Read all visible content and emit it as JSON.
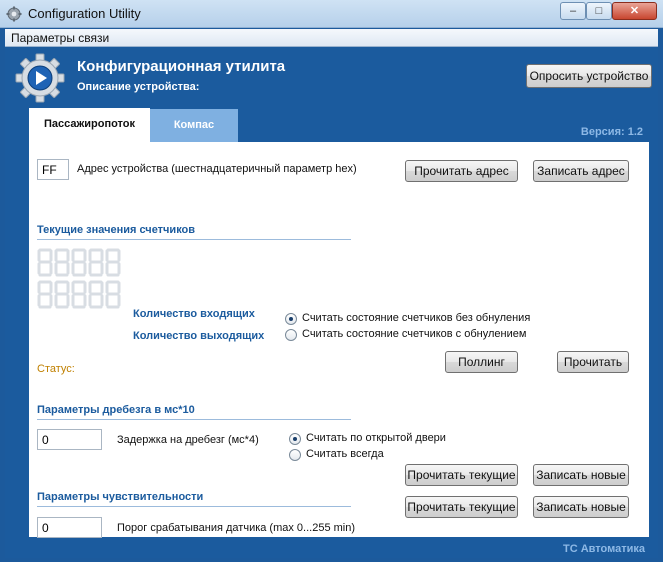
{
  "window": {
    "title": "Configuration Utility",
    "minimize": "–",
    "maximize": "□",
    "close": "✕"
  },
  "menu": {
    "items": [
      "Параметры связи"
    ]
  },
  "header": {
    "title": "Конфигурационная утилита",
    "subtitle": "Описание устройства:",
    "query_button": "Опросить устройство"
  },
  "tabs": [
    {
      "label": "Пассажиропоток",
      "active": true
    },
    {
      "label": "Компас",
      "active": false
    }
  ],
  "version": "Версия: 1.2",
  "address": {
    "value": "FF",
    "label": "Адрес устройства (шестнадцатеричный параметр hex)",
    "read_button": "Прочитать адрес",
    "write_button": "Записать адрес"
  },
  "counters": {
    "title": "Текущие значения счетчиков",
    "in_label": "Количество входящих",
    "out_label": "Количество выходящих",
    "status_label": "Статус:",
    "radio_options": [
      {
        "label": "Считать состояние счетчиков без обнуления",
        "selected": true
      },
      {
        "label": "Считать состояние счетчиков с обнулением",
        "selected": false
      }
    ],
    "polling_button": "Поллинг",
    "read_button": "Прочитать"
  },
  "debounce": {
    "title": "Параметры дребезга в мс*10",
    "value": "0",
    "label": "Задержка на дребезг (мс*4)",
    "radio_options": [
      {
        "label": "Считать по открытой двери",
        "selected": true
      },
      {
        "label": "Считать всегда",
        "selected": false
      }
    ],
    "read_button": "Прочитать текущие",
    "write_button": "Записать новые"
  },
  "sensitivity": {
    "title": "Параметры чувствительности",
    "value": "0",
    "label": "Порог срабатывания датчика (max 0...255 min)",
    "read_button": "Прочитать текущие",
    "write_button": "Записать новые"
  },
  "footer": "ТС Автоматика",
  "colors": {
    "background": "#1b5b9e",
    "section_title": "#1b5b9e",
    "status": "#c08000",
    "version_text": "#8eb9e6",
    "inactive_tab": "#7fb0e1"
  },
  "icons": {
    "app": "gear-icon",
    "header": "gear-play-icon"
  }
}
